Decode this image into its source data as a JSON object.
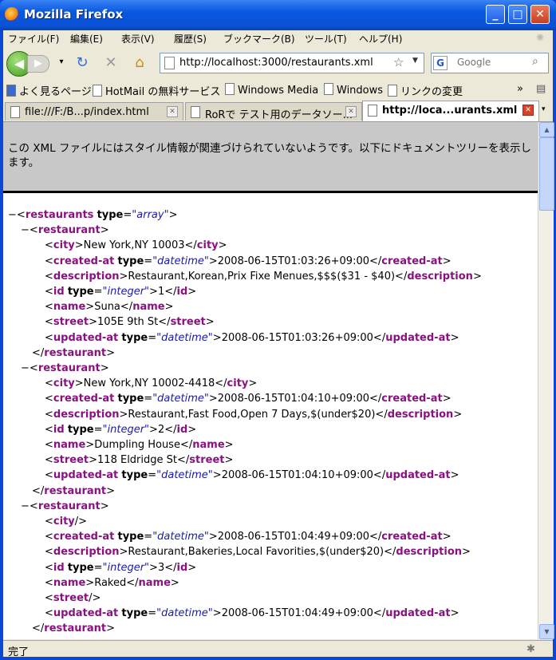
{
  "window": {
    "title": "Mozilla Firefox",
    "min": "_",
    "max": "□",
    "close": "✕"
  },
  "menu": [
    "ファイル(F)",
    "編集(E)",
    "表示(V)",
    "履歴(S)",
    "ブックマーク(B)",
    "ツール(T)",
    "ヘルプ(H)"
  ],
  "nav": {
    "url": "http://localhost:3000/restaurants.xml",
    "search_placeholder": "Google"
  },
  "bookmarks": [
    "よく見るページ",
    "HotMail の無料サービス",
    "Windows Media",
    "Windows",
    "リンクの変更"
  ],
  "bookmarks_more": "»",
  "tabs": [
    {
      "label": "file:///F:/B...p/index.html",
      "active": false
    },
    {
      "label": "RoRで テスト用のデータソー...",
      "active": false
    },
    {
      "label": "http://loca...urants.xml",
      "active": true
    }
  ],
  "info": "この XML ファイルにはスタイル情報が関連づけられていないようです。以下にドキュメントツリーを表示します。",
  "status": "完了",
  "xml": {
    "root_tag": "restaurants",
    "root_attr": "type",
    "root_attr_val": "array",
    "item_tag": "restaurant",
    "restaurants": [
      {
        "city": "New York,NY 10003",
        "created_at": "2008-06-15T01:03:26+09:00",
        "description": "Restaurant,Korean,Prix Fixe Menues,$$$($31 - $40)",
        "id": "1",
        "name": "Suna",
        "street": "105E 9th St",
        "updated_at": "2008-06-15T01:03:26+09:00"
      },
      {
        "city": "New York,NY 10002-4418",
        "created_at": "2008-06-15T01:04:10+09:00",
        "description": "Restaurant,Fast Food,Open 7 Days,$(under$20)",
        "id": "2",
        "name": "Dumpling House",
        "street": "118 Eldridge St",
        "updated_at": "2008-06-15T01:04:10+09:00"
      },
      {
        "city": "",
        "created_at": "2008-06-15T01:04:49+09:00",
        "description": "Restaurant,Bakeries,Local Favorities,$(under$20)",
        "id": "3",
        "name": "Raked",
        "street": "",
        "updated_at": "2008-06-15T01:04:49+09:00"
      }
    ]
  }
}
